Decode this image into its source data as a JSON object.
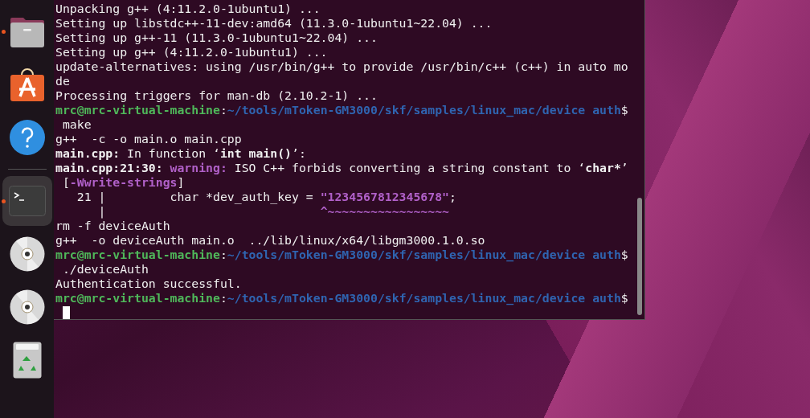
{
  "dock": {
    "items": [
      {
        "kind": "files",
        "running": true,
        "active": false
      },
      {
        "kind": "software",
        "running": false,
        "active": false
      },
      {
        "kind": "help",
        "running": false,
        "active": false
      },
      {
        "kind": "separator"
      },
      {
        "kind": "terminal",
        "running": true,
        "active": true
      },
      {
        "kind": "disc",
        "running": false,
        "active": false
      },
      {
        "kind": "disc",
        "running": false,
        "active": false
      },
      {
        "kind": "trash",
        "running": false,
        "active": false
      }
    ]
  },
  "terminal": {
    "cursor_visible": true,
    "lines": [
      [
        {
          "text": "Unpacking g++ (4:11.2.0-1ubuntu1) ...",
          "kind": "plain"
        }
      ],
      [
        {
          "text": "Setting up libstdc++-11-dev:amd64 (11.3.0-1ubuntu1~22.04) ...",
          "kind": "plain"
        }
      ],
      [
        {
          "text": "Setting up g++-11 (11.3.0-1ubuntu1~22.04) ...",
          "kind": "plain"
        }
      ],
      [
        {
          "text": "Setting up g++ (4:11.2.0-1ubuntu1) ...",
          "kind": "plain"
        }
      ],
      [
        {
          "text": "update-alternatives: using /usr/bin/g++ to provide /usr/bin/c++ (c++) in auto mo",
          "kind": "plain"
        }
      ],
      [
        {
          "text": "de",
          "kind": "plain"
        }
      ],
      [
        {
          "text": "Processing triggers for man-db (2.10.2-1) ...",
          "kind": "plain"
        }
      ],
      [
        {
          "text": "mrc@mrc-virtual-machine",
          "kind": "user"
        },
        {
          "text": ":",
          "kind": "plain"
        },
        {
          "text": "~/tools/mToken-GM3000/skf/samples/linux_mac/device auth",
          "kind": "path"
        },
        {
          "text": "$",
          "kind": "plain"
        }
      ],
      [
        {
          "text": " make",
          "kind": "plain"
        }
      ],
      [
        {
          "text": "g++  -c -o main.o main.cpp",
          "kind": "plain"
        }
      ],
      [
        {
          "text": "main.cpp:",
          "kind": "bold"
        },
        {
          "text": " In function ‘",
          "kind": "plain"
        },
        {
          "text": "int main()",
          "kind": "bold"
        },
        {
          "text": "’:",
          "kind": "plain"
        }
      ],
      [
        {
          "text": "main.cpp:21:30: ",
          "kind": "bold"
        },
        {
          "text": "warning:",
          "kind": "warning"
        },
        {
          "text": " ISO C++ forbids converting a string constant to ‘",
          "kind": "plain"
        },
        {
          "text": "char*",
          "kind": "bold"
        },
        {
          "text": "’",
          "kind": "plain"
        }
      ],
      [
        {
          "text": " [",
          "kind": "plain"
        },
        {
          "text": "-Wwrite-strings",
          "kind": "warning"
        },
        {
          "text": "]",
          "kind": "plain"
        }
      ],
      [
        {
          "text": "   21 |         char *dev_auth_key = ",
          "kind": "plain"
        },
        {
          "text": "\"1234567812345678\"",
          "kind": "warning"
        },
        {
          "text": ";",
          "kind": "plain"
        }
      ],
      [
        {
          "text": "      |                              ",
          "kind": "plain"
        },
        {
          "text": "^~~~~~~~~~~~~~~~~~",
          "kind": "warning"
        }
      ],
      [
        {
          "text": "rm -f deviceAuth",
          "kind": "plain"
        }
      ],
      [
        {
          "text": "g++  -o deviceAuth main.o  ../lib/linux/x64/libgm3000.1.0.so",
          "kind": "plain"
        }
      ],
      [
        {
          "text": "mrc@mrc-virtual-machine",
          "kind": "user"
        },
        {
          "text": ":",
          "kind": "plain"
        },
        {
          "text": "~/tools/mToken-GM3000/skf/samples/linux_mac/device auth",
          "kind": "path"
        },
        {
          "text": "$",
          "kind": "plain"
        }
      ],
      [
        {
          "text": " ./deviceAuth",
          "kind": "plain"
        }
      ],
      [
        {
          "text": "Authentication successful.",
          "kind": "plain"
        }
      ],
      [
        {
          "text": "mrc@mrc-virtual-machine",
          "kind": "user"
        },
        {
          "text": ":",
          "kind": "plain"
        },
        {
          "text": "~/tools/mToken-GM3000/skf/samples/linux_mac/device auth",
          "kind": "path"
        },
        {
          "text": "$",
          "kind": "plain"
        }
      ]
    ]
  }
}
